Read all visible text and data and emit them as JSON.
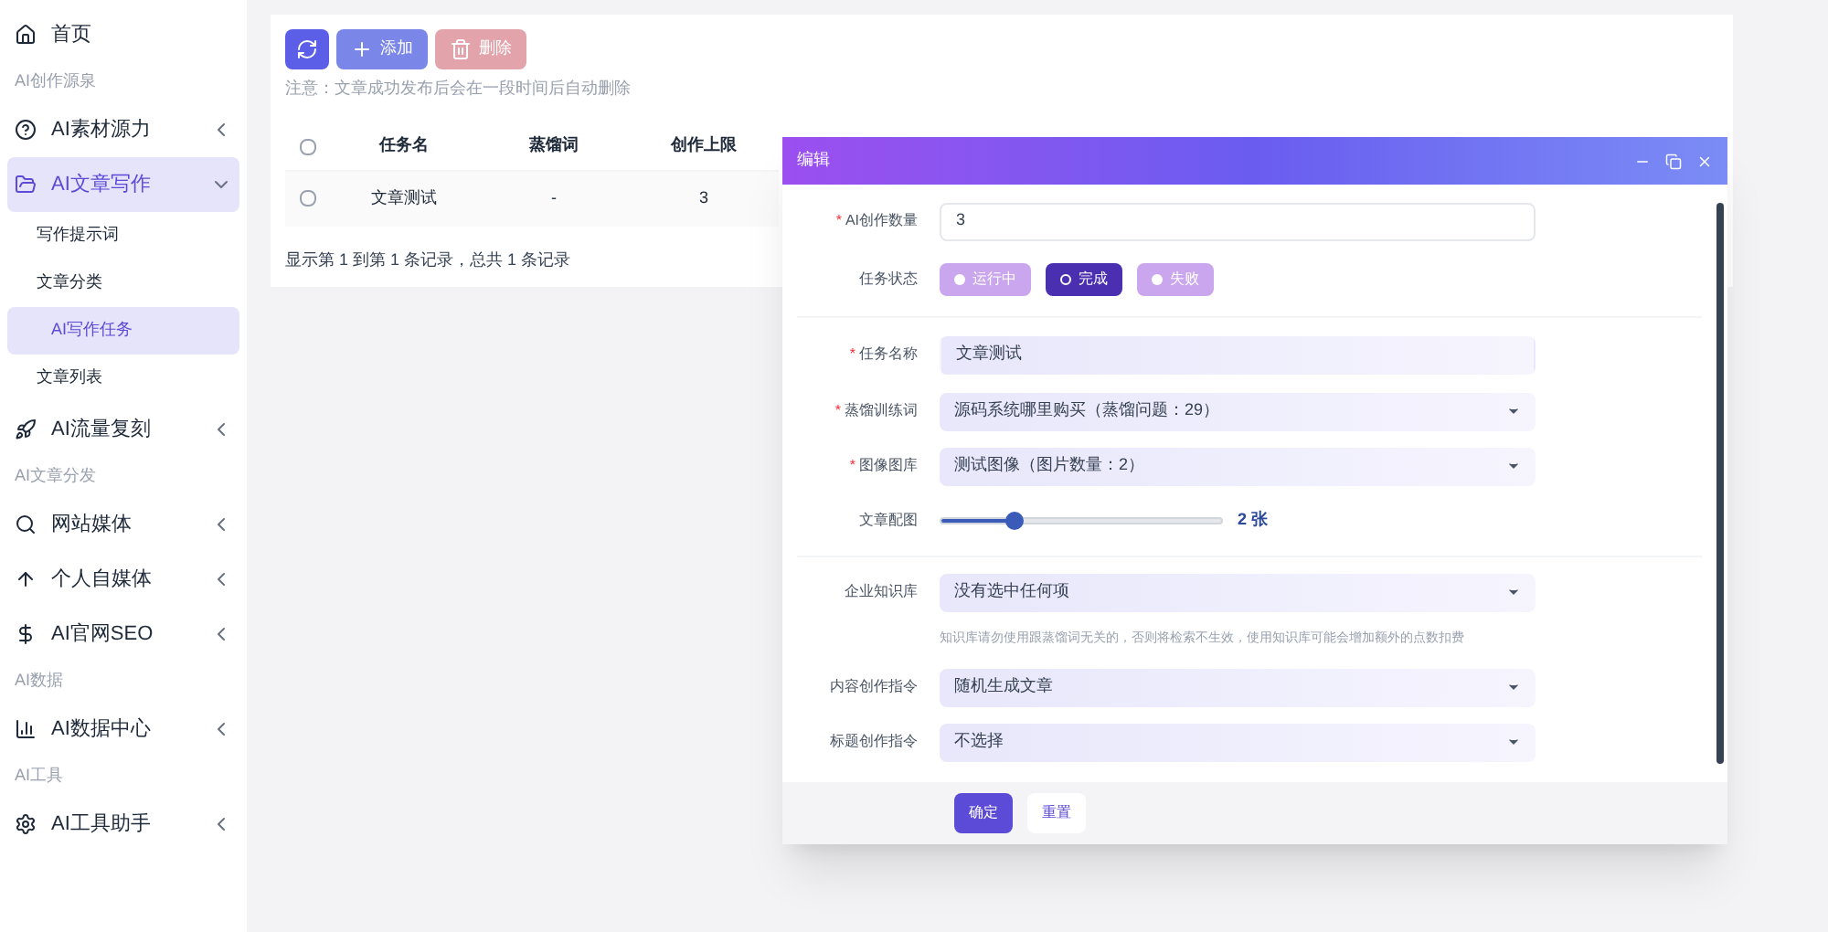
{
  "sidebar": {
    "items": [
      {
        "kind": "item",
        "label": "首页",
        "selected": false
      },
      {
        "kind": "section",
        "label": "AI创作源泉"
      },
      {
        "kind": "item",
        "label": "AI素材源力",
        "selected": false,
        "expanded": false
      },
      {
        "kind": "item",
        "label": "AI文章写作",
        "selected": true,
        "expanded": true,
        "children": [
          {
            "label": "写作提示词",
            "selected": false
          },
          {
            "label": "文章分类",
            "selected": false
          },
          {
            "label": "AI写作任务",
            "selected": true
          },
          {
            "label": "文章列表",
            "selected": false
          }
        ]
      },
      {
        "kind": "item",
        "label": "AI流量复刻",
        "selected": false,
        "expanded": false
      },
      {
        "kind": "section",
        "label": "AI文章分发"
      },
      {
        "kind": "item",
        "label": "网站媒体",
        "selected": false,
        "expanded": false
      },
      {
        "kind": "item",
        "label": "个人自媒体",
        "selected": false,
        "expanded": false
      },
      {
        "kind": "item",
        "label": "AI官网SEO",
        "selected": false,
        "expanded": false
      },
      {
        "kind": "section",
        "label": "AI数据"
      },
      {
        "kind": "item",
        "label": "AI数据中心",
        "selected": false,
        "expanded": false
      },
      {
        "kind": "section",
        "label": "AI工具"
      },
      {
        "kind": "item",
        "label": "AI工具助手",
        "selected": false,
        "expanded": false
      }
    ]
  },
  "toolbar": {
    "buttons": [
      {
        "kind": "refresh"
      },
      {
        "kind": "add",
        "label": "添加"
      },
      {
        "kind": "delete",
        "label": "删除",
        "disabled": true
      }
    ]
  },
  "notice": "注意：文章成功发布后会在一段时间后自动删除",
  "table": {
    "header_checked": false,
    "columns": [
      "任务名",
      "蒸馏词",
      "创作上限"
    ],
    "rows": [
      {
        "checked": false,
        "cells": [
          "文章测试",
          "-",
          "3"
        ]
      }
    ]
  },
  "pagination": "显示第 1 到第 1 条记录，总共 1 条记录",
  "dialog": {
    "title": "编辑",
    "fields": [
      {
        "kind": "input",
        "label": "AI创作数量",
        "required_mark": "*",
        "value": "3"
      },
      {
        "kind": "radio",
        "label": "任务状态",
        "options": [
          {
            "label": "运行中",
            "selected": false
          },
          {
            "label": "完成",
            "selected": true
          },
          {
            "label": "失败",
            "selected": false
          }
        ]
      },
      {
        "kind": "divider"
      },
      {
        "kind": "input",
        "label": "任务名称",
        "required_mark": "*",
        "value": "文章测试"
      },
      {
        "kind": "select",
        "label": "蒸馏训练词",
        "required_mark": "*",
        "value": "源码系统哪里购买（蒸馏问题：29）"
      },
      {
        "kind": "select",
        "label": "图像图库",
        "required_mark": "*",
        "value": "测试图像（图片数量：2）"
      },
      {
        "kind": "slider",
        "label": "文章配图",
        "level": 0.26,
        "reading": "2 张"
      },
      {
        "kind": "divider"
      },
      {
        "kind": "select",
        "label": "企业知识库",
        "value": "没有选中任何项",
        "help": "知识库请勿使用跟蒸馏词无关的，否则将检索不生效，使用知识库可能会增加额外的点数扣费"
      },
      {
        "kind": "select",
        "label": "内容创作指令",
        "value": "随机生成文章"
      },
      {
        "kind": "select",
        "label": "标题创作指令",
        "value": "不选择"
      }
    ],
    "buttons": [
      {
        "kind": "primary",
        "label": "确定"
      },
      {
        "kind": "plain",
        "label": "重置"
      }
    ]
  }
}
